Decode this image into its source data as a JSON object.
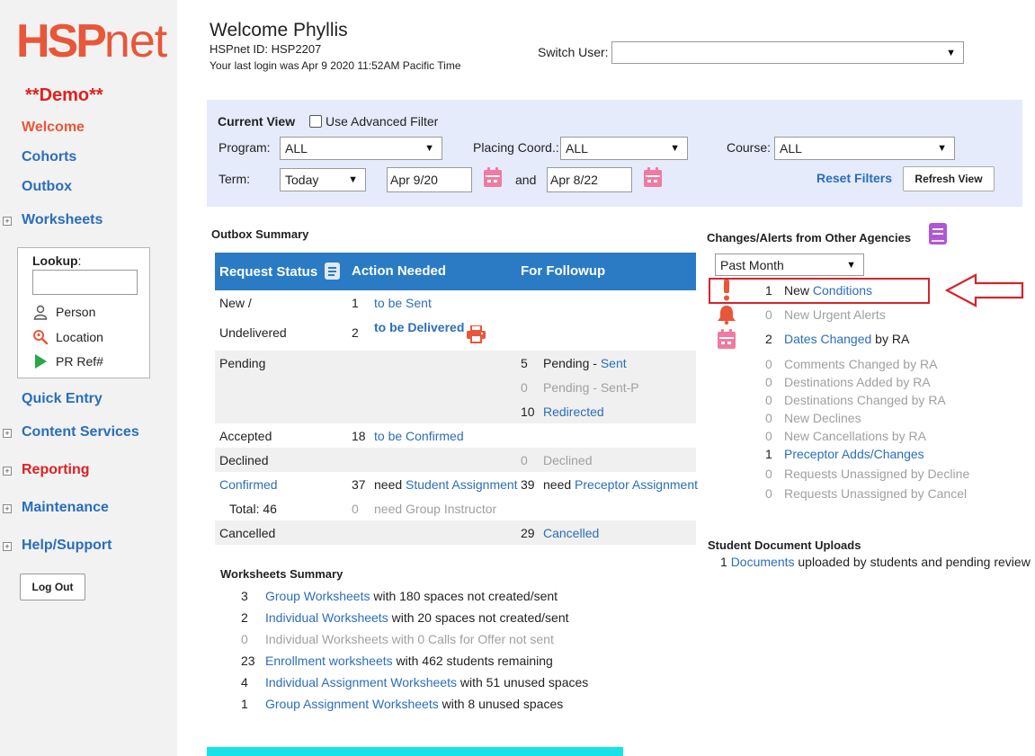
{
  "sidebar": {
    "logo_main": "HSP",
    "logo_suffix": "net",
    "demo_label": "**Demo**",
    "nav": {
      "welcome": "Welcome",
      "cohorts": "Cohorts",
      "outbox": "Outbox",
      "worksheets": "Worksheets",
      "quick_entry": "Quick Entry",
      "content_services": "Content Services",
      "reporting": "Reporting",
      "maintenance": "Maintenance",
      "help_support": "Help/Support"
    },
    "lookup": {
      "title": "Lookup",
      "colon": ":",
      "person": "Person",
      "location": "Location",
      "pr_ref": "PR Ref#"
    },
    "logout_label": "Log Out"
  },
  "header": {
    "welcome": "Welcome Phyllis",
    "hspnet_id": "HSPnet ID: HSP2207",
    "last_login": "Your last login was Apr 9 2020 11:52AM Pacific Time",
    "switch_user_label": "Switch User:",
    "switch_user_value": ""
  },
  "filter": {
    "current_view": "Current View",
    "advanced_filter_label": "Use Advanced Filter",
    "program_label": "Program:",
    "program_value": "ALL",
    "placing_coord_label": "Placing Coord.:",
    "placing_coord_value": "ALL",
    "course_label": "Course:",
    "course_value": "ALL",
    "term_label": "Term:",
    "term_value": "Today",
    "date_from": "Apr 9/20",
    "and_label": "and",
    "date_to": "Apr 8/22",
    "reset_filters": "Reset Filters",
    "refresh_view": "Refresh View"
  },
  "outbox": {
    "title": "Outbox Summary",
    "headers": {
      "request_status": "Request Status",
      "action_needed": "Action Needed",
      "for_followup": "For Followup"
    },
    "new_label": "New /",
    "undelivered_label": "Undelivered",
    "to_be_sent_count": "1",
    "to_be_sent": "to be Sent",
    "to_be_delivered_count": "2",
    "to_be_delivered": "to be Delivered",
    "pending_label": "Pending",
    "pending_sent_count": "5",
    "pending_sent_prefix": "Pending - ",
    "pending_sent_link": "Sent",
    "pending_sentp_count": "0",
    "pending_sentp": "Pending - Sent-P",
    "redirected_count": "10",
    "redirected": "Redirected",
    "accepted_label": "Accepted",
    "to_be_confirmed_count": "18",
    "to_be_confirmed": "to be Confirmed",
    "declined_label": "Declined",
    "declined_count": "0",
    "declined": "Declined",
    "confirmed_label": "Confirmed",
    "student_assign_count": "37",
    "need_prefix": "need ",
    "student_assign": "Student Assignment",
    "preceptor_assign_count": "39",
    "preceptor_assign": "Preceptor Assignment",
    "total_label": "Total: 46",
    "group_instructor_count": "0",
    "group_instructor": "need Group Instructor",
    "cancelled_label": "Cancelled",
    "cancelled_count": "29",
    "cancelled": "Cancelled"
  },
  "worksheets": {
    "title": "Worksheets Summary",
    "rows": [
      {
        "count": "3",
        "link": "Group Worksheets",
        "rest": " with 180 spaces not created/sent",
        "muted": false
      },
      {
        "count": "2",
        "link": "Individual Worksheets",
        "rest": " with 20 spaces not created/sent",
        "muted": false
      },
      {
        "count": "0",
        "link": "",
        "rest": "Individual Worksheets with 0 Calls for Offer not sent",
        "muted": true
      },
      {
        "count": "23",
        "link": "Enrollment worksheets",
        "rest": " with 462 students remaining",
        "muted": false
      },
      {
        "count": "4",
        "link": "Individual Assignment Worksheets",
        "rest": " with 51 unused spaces",
        "muted": false
      },
      {
        "count": "1",
        "link": "Group Assignment Worksheets",
        "rest": " with 8 unused spaces",
        "muted": false
      }
    ]
  },
  "alerts": {
    "title": "Changes/Alerts from Other Agencies",
    "period": "Past Month",
    "new_conditions_count": "1",
    "new_conditions_prefix": "New ",
    "new_conditions_link": "Conditions",
    "urgent_count": "0",
    "urgent": "New Urgent Alerts",
    "dates_changed_count": "2",
    "dates_changed_link": "Dates Changed",
    "dates_changed_suffix": " by RA",
    "rows": [
      {
        "count": "0",
        "text": "Comments Changed by RA",
        "link": false
      },
      {
        "count": "0",
        "text": "Destinations Added by RA",
        "link": false
      },
      {
        "count": "0",
        "text": "Destinations Changed by RA",
        "link": false
      },
      {
        "count": "0",
        "text": "New Declines",
        "link": false
      },
      {
        "count": "0",
        "text": "New Cancellations by RA",
        "link": false
      },
      {
        "count": "1",
        "text": "Preceptor Adds/Changes",
        "link": true
      },
      {
        "count": "0",
        "text": "Requests Unassigned by Decline",
        "link": false
      },
      {
        "count": "0",
        "text": "Requests Unassigned by Cancel",
        "link": false
      }
    ]
  },
  "uploads": {
    "title": "Student Document Uploads",
    "count": "1",
    "link": "Documents",
    "rest": " uploaded by students and pending review"
  },
  "colors": {
    "brand_orange": "#e8573a",
    "link_blue": "#2a6ebb",
    "table_header_blue": "#2a7bc4",
    "filter_bg": "#e5ebfb",
    "alert_red": "#d4242a",
    "calendar_pink": "#f07aa0",
    "book_purple": "#b057d6",
    "cyan_bar": "#17e2ea"
  }
}
